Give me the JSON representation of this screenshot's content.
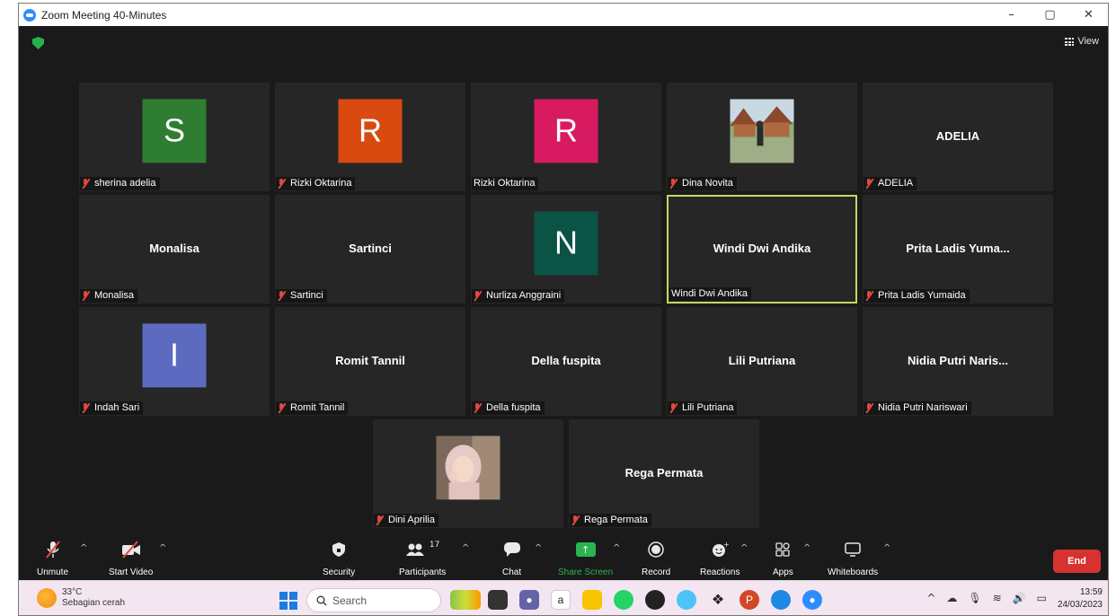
{
  "window": {
    "title": "Zoom Meeting 40-Minutes",
    "minimize": "–",
    "restore": "▢",
    "close": "✕"
  },
  "meeting": {
    "view_label": "View",
    "tiles": [
      {
        "kind": "avatar",
        "initial": "S",
        "color": "#2e7d32",
        "label": "sherina adelia",
        "muted": true
      },
      {
        "kind": "avatar",
        "initial": "R",
        "color": "#d84a10",
        "label": "Rizki Oktarina",
        "muted": true
      },
      {
        "kind": "avatar",
        "initial": "R",
        "color": "#d81b60",
        "label": "Rizki Oktarina",
        "muted": false
      },
      {
        "kind": "photo",
        "label": "Dina Novita",
        "muted": true
      },
      {
        "kind": "name",
        "display": "ADELIA",
        "label": "ADELIA",
        "muted": true
      },
      {
        "kind": "name",
        "display": "Monalisa",
        "label": "Monalisa",
        "muted": true
      },
      {
        "kind": "name",
        "display": "Sartinci",
        "label": "Sartinci",
        "muted": true
      },
      {
        "kind": "avatar",
        "initial": "N",
        "color": "#0b5345",
        "label": "Nurliza Anggraini",
        "muted": true
      },
      {
        "kind": "name",
        "display": "Windi Dwi Andika",
        "label": "Windi Dwi Andika",
        "muted": false,
        "active": true
      },
      {
        "kind": "name",
        "display": "Prita Ladis Yuma...",
        "label": "Prita Ladis Yumaida",
        "muted": true
      },
      {
        "kind": "avatar",
        "initial": "I",
        "color": "#5c6bc0",
        "label": "Indah Sari",
        "muted": true
      },
      {
        "kind": "name",
        "display": "Romit Tannil",
        "label": "Romit Tannil",
        "muted": true
      },
      {
        "kind": "name",
        "display": "Della fuspita",
        "label": "Della fuspita",
        "muted": true
      },
      {
        "kind": "name",
        "display": "Lili Putriana",
        "label": "Lili Putriana",
        "muted": true
      },
      {
        "kind": "name",
        "display": "Nidia Putri Naris...",
        "label": "Nidia Putri Nariswari",
        "muted": true
      },
      {
        "kind": "photo2",
        "label": "Dini Aprilia",
        "muted": true
      },
      {
        "kind": "name",
        "display": "Rega Permata",
        "label": "Rega Permata",
        "muted": true
      }
    ]
  },
  "toolbar": {
    "unmute": "Unmute",
    "start_video": "Start Video",
    "security": "Security",
    "participants": "Participants",
    "participants_count": "17",
    "chat": "Chat",
    "share_screen": "Share Screen",
    "record": "Record",
    "reactions": "Reactions",
    "apps": "Apps",
    "whiteboards": "Whiteboards",
    "end": "End",
    "share_color": "#2bb34f"
  },
  "taskbar": {
    "temperature": "33°C",
    "weather_desc": "Sebagian cerah",
    "search_placeholder": "Search",
    "time": "13:59",
    "date": "24/03/2023"
  }
}
